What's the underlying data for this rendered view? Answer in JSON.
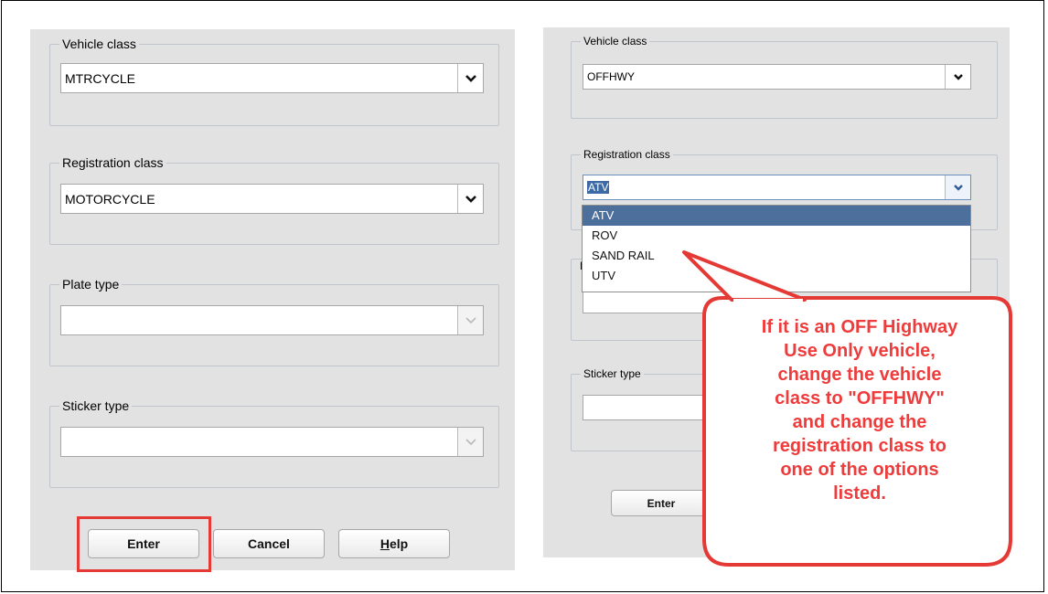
{
  "left": {
    "vehicle_class": {
      "legend": "Vehicle class",
      "value": "MTRCYCLE"
    },
    "registration_class": {
      "legend": "Registration class",
      "value": "MOTORCYCLE"
    },
    "plate_type": {
      "legend": "Plate type",
      "value": ""
    },
    "sticker_type": {
      "legend": "Sticker type",
      "value": ""
    },
    "buttons": {
      "enter": "Enter",
      "cancel": "Cancel",
      "help_rest": "elp",
      "help_mnemonic": "H"
    }
  },
  "right": {
    "vehicle_class": {
      "legend": "Vehicle class",
      "value": "OFFHWY"
    },
    "registration_class": {
      "legend": "Registration class",
      "value": "ATV"
    },
    "dropdown_options": [
      "ATV",
      "ROV",
      "SAND RAIL",
      "UTV"
    ],
    "partial_label": "F",
    "sticker_type": {
      "legend": "Sticker type",
      "value": ""
    },
    "buttons": {
      "enter": "Enter"
    }
  },
  "callout": {
    "lines": [
      "If it is an OFF Highway",
      "Use Only vehicle,",
      "change the vehicle",
      "class to \"OFFHWY\"",
      "and change the",
      "registration class to",
      "one of the options",
      "listed."
    ],
    "color": "#ee3b3b"
  },
  "colors": {
    "panel": "#e2e2e2",
    "selection": "#4d6f9c",
    "highlight": "#e53935"
  },
  "icons": {
    "dropdown": "chevron-down-icon"
  }
}
